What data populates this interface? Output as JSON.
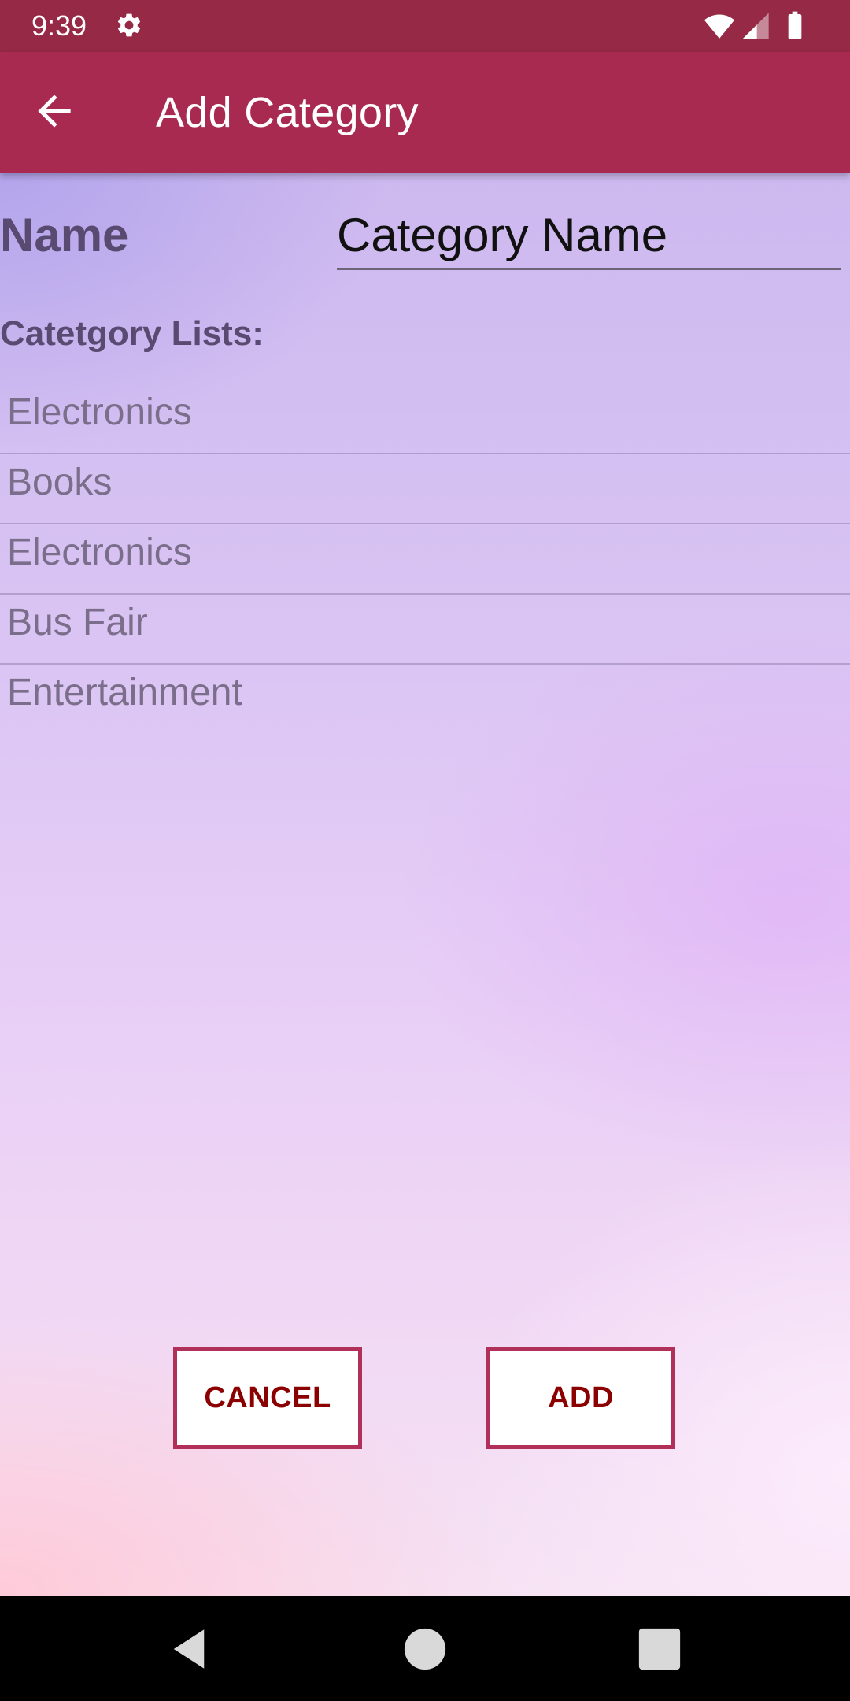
{
  "status_bar": {
    "time": "9:39",
    "icons": [
      "settings-gear-icon",
      "wifi-icon",
      "cell-signal-icon",
      "battery-icon"
    ]
  },
  "app_bar": {
    "title": "Add Category",
    "back_icon": "arrow-back-icon",
    "color": "#a92a50"
  },
  "form": {
    "name_label": "Name",
    "name_input": {
      "value": "",
      "placeholder": "Category Name"
    }
  },
  "category_list": {
    "header": "Catetgory Lists:",
    "items": [
      {
        "label": "Electronics"
      },
      {
        "label": "Books"
      },
      {
        "label": "Electronics"
      },
      {
        "label": "Bus Fair"
      },
      {
        "label": "Entertainment"
      }
    ]
  },
  "actions": {
    "cancel_label": "CANCEL",
    "add_label": "ADD",
    "border_color": "#b0305a",
    "text_color": "#8b0000"
  },
  "nav_bar": {
    "icons": [
      "nav-back-icon",
      "nav-home-icon",
      "nav-recents-icon"
    ]
  }
}
